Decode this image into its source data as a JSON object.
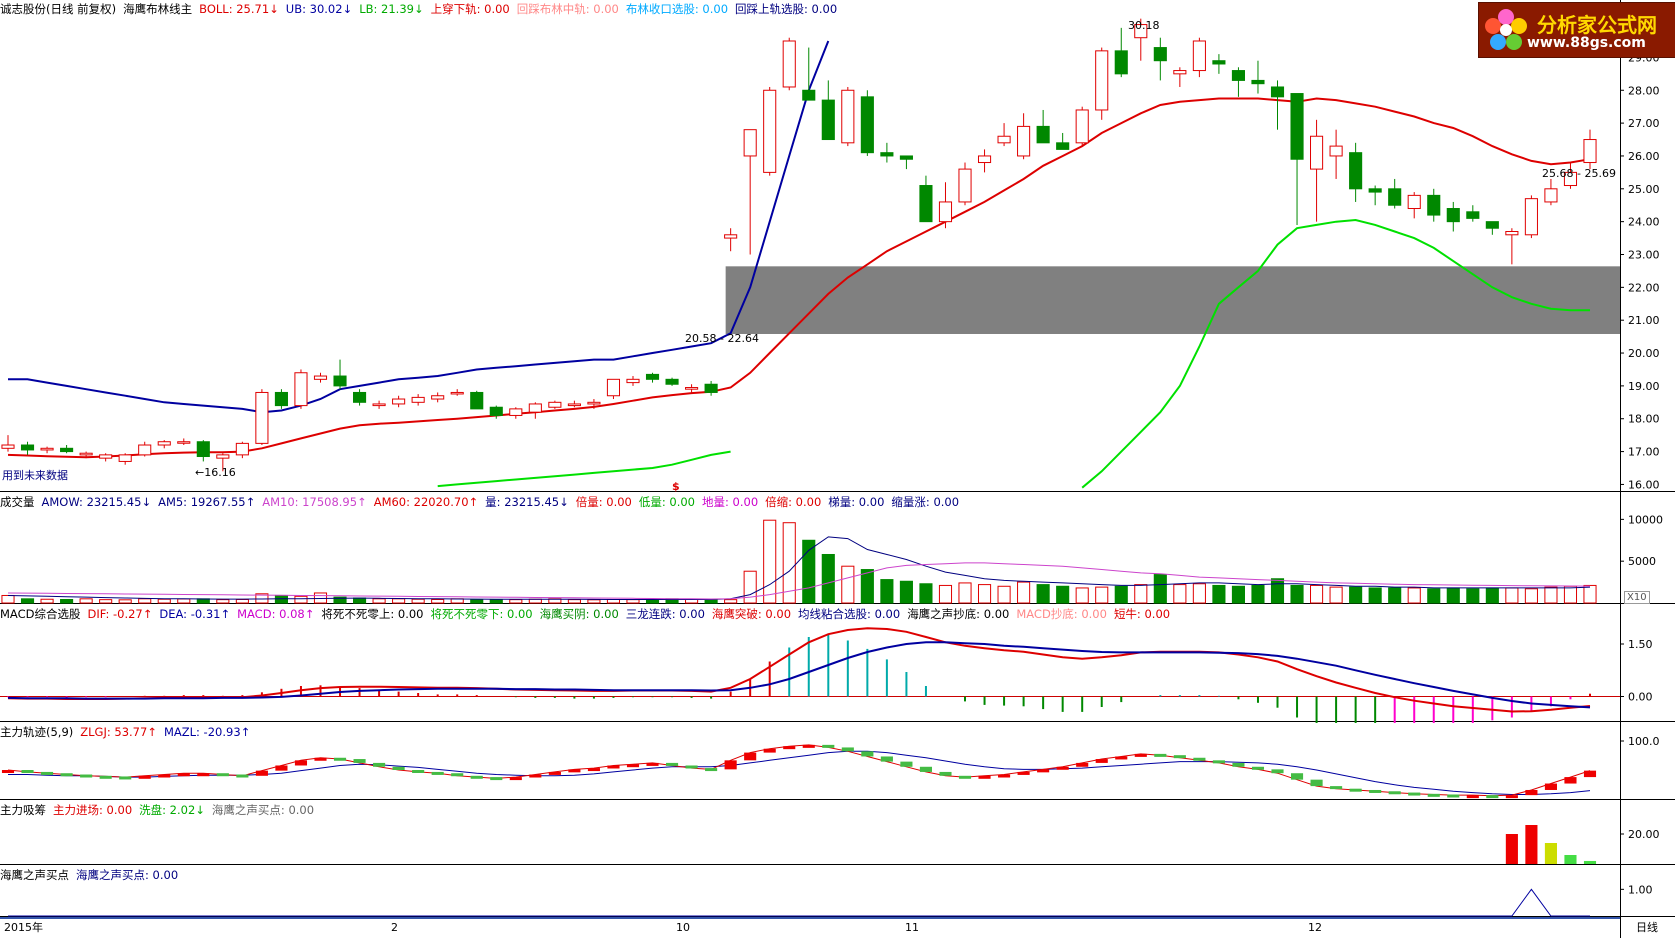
{
  "colors": {
    "up": "#e00000",
    "down": "#008800",
    "upper_band": "#0000a0",
    "mid_band": "#dd0000",
    "lower_band": "#00e000",
    "axis": "#000000",
    "ma_purple": "#cc44cc"
  },
  "logo": {
    "brand": "分析家公式网",
    "url": "www.88gs.com"
  },
  "header_main": {
    "stock": "诚志股份(日线 前复权)",
    "indicator": "海鹰布林线主",
    "boll": "BOLL: 25.71↓",
    "ub": "UB: 30.02↓",
    "lb": "LB: 21.39↓",
    "cross": "上穿下轨: 0.00",
    "mid_back": "回踩布林中轨: 0.00",
    "shrink": "布林收口选股: 0.00",
    "upper_back": "回踩上轨选股: 0.00"
  },
  "header_vol": {
    "title": "成交量",
    "amow": "AMOW: 23215.45↓",
    "am5": "AM5: 19267.55↑",
    "am10": "AM10: 17508.95↑",
    "am60": "AM60: 22020.70↑",
    "vol": "量: 23215.45↓",
    "bei": "倍量: 0.00",
    "di": "低量: 0.00",
    "di2": "地量: 0.00",
    "bei2": "倍缩: 0.00",
    "ti": "梯量: 0.00",
    "suo": "缩量涨: 0.00"
  },
  "header_macd": {
    "title": "MACD综合选股",
    "dif": "DIF: -0.27↑",
    "dea": "DEA: -0.31↑",
    "macd": "MACD: 0.08↑",
    "s1": "将死不死零上: 0.00",
    "s2": "将死不死零下: 0.00",
    "s3": "海鹰买阴: 0.00",
    "s4": "三龙连跌: 0.00",
    "s5": "海鹰突破: 0.00",
    "s6": "均线粘合选股: 0.00",
    "s7": "海鹰之声抄底: 0.00",
    "s8": "MACD抄底: 0.00",
    "s9": "短牛: 0.00"
  },
  "header_main_force": {
    "title": "主力轨迹(5,9)",
    "zlgj": "ZLGJ: 53.77↑",
    "mazl": "MAZL: -20.93↑"
  },
  "header_absorb": {
    "title": "主力吸筹",
    "in": "主力进场: 0.00",
    "wash": "洗盘: 2.02↓",
    "buy": "海鹰之声买点: 0.00"
  },
  "header_buy": {
    "title": "海鹰之声买点",
    "value": "海鹰之声买点: 0.00"
  },
  "annotations": {
    "future": "用到未来数据",
    "low": "←16.16",
    "high": "30.18",
    "box_left": "20.58 - 22.64",
    "box_right": "25.68 - 25.69",
    "x10": "X10",
    "s_mark": "$"
  },
  "timeline": {
    "labels": [
      "2015年",
      "2",
      "10",
      "11",
      "12"
    ],
    "mode": "日线"
  },
  "axes": {
    "price": [
      "29.00",
      "28.00",
      "27.00",
      "26.00",
      "25.00",
      "24.00",
      "23.00",
      "22.00",
      "21.00",
      "20.00",
      "19.00",
      "18.00",
      "17.00",
      "16.00"
    ],
    "volume": [
      "10000",
      "5000"
    ],
    "macd": [
      "1.50",
      "0.00"
    ],
    "force": [
      "100.0"
    ],
    "absorb": [
      "20.00"
    ],
    "buy": [
      "1.00"
    ]
  },
  "chart_data": {
    "type": "candlestick",
    "candles": [
      [
        17.1,
        17.5,
        17.0,
        17.2
      ],
      [
        17.2,
        17.3,
        16.9,
        17.05
      ],
      [
        17.05,
        17.15,
        16.95,
        17.1
      ],
      [
        17.1,
        17.2,
        16.95,
        17.0
      ],
      [
        16.9,
        17.0,
        16.8,
        16.95
      ],
      [
        16.8,
        16.95,
        16.7,
        16.9
      ],
      [
        16.7,
        16.95,
        16.6,
        16.9
      ],
      [
        16.9,
        17.3,
        16.85,
        17.2
      ],
      [
        17.2,
        17.35,
        17.1,
        17.3
      ],
      [
        17.3,
        17.4,
        17.2,
        17.3
      ],
      [
        17.3,
        17.35,
        16.7,
        16.85
      ],
      [
        16.8,
        16.95,
        16.4,
        16.9
      ],
      [
        16.9,
        17.3,
        16.8,
        17.25
      ],
      [
        17.25,
        18.9,
        17.2,
        18.8
      ],
      [
        18.8,
        18.9,
        18.3,
        18.4
      ],
      [
        18.4,
        19.5,
        18.3,
        19.4
      ],
      [
        19.2,
        19.4,
        19.1,
        19.3
      ],
      [
        19.3,
        19.8,
        18.9,
        19.0
      ],
      [
        18.8,
        18.9,
        18.4,
        18.5
      ],
      [
        18.4,
        18.55,
        18.3,
        18.45
      ],
      [
        18.45,
        18.7,
        18.35,
        18.6
      ],
      [
        18.5,
        18.75,
        18.4,
        18.65
      ],
      [
        18.6,
        18.8,
        18.5,
        18.7
      ],
      [
        18.8,
        18.9,
        18.7,
        18.8
      ],
      [
        18.8,
        18.85,
        18.3,
        18.3
      ],
      [
        18.35,
        18.4,
        18.0,
        18.1
      ],
      [
        18.1,
        18.35,
        18.0,
        18.3
      ],
      [
        18.2,
        18.5,
        18.0,
        18.45
      ],
      [
        18.35,
        18.55,
        18.3,
        18.5
      ],
      [
        18.4,
        18.55,
        18.35,
        18.45
      ],
      [
        18.45,
        18.6,
        18.3,
        18.5
      ],
      [
        18.7,
        19.2,
        18.6,
        19.2
      ],
      [
        19.1,
        19.3,
        19.0,
        19.2
      ],
      [
        19.35,
        19.4,
        19.1,
        19.2
      ],
      [
        19.2,
        19.25,
        19.0,
        19.05
      ],
      [
        18.9,
        19.05,
        18.8,
        18.95
      ],
      [
        19.05,
        19.15,
        18.7,
        18.8
      ],
      [
        23.5,
        23.8,
        23.1,
        23.6
      ],
      [
        26.0,
        26.5,
        23.0,
        26.8
      ],
      [
        25.5,
        28.1,
        25.4,
        28.0
      ],
      [
        28.1,
        29.6,
        28.0,
        29.5
      ],
      [
        28.0,
        29.3,
        27.8,
        27.7
      ],
      [
        27.7,
        28.3,
        27.5,
        26.5
      ],
      [
        26.4,
        28.1,
        26.3,
        28.0
      ],
      [
        27.8,
        28.0,
        26.0,
        26.1
      ],
      [
        26.1,
        26.4,
        25.8,
        26.0
      ],
      [
        26.0,
        25.8,
        25.6,
        25.9
      ],
      [
        25.1,
        25.4,
        24.0,
        24.0
      ],
      [
        24.0,
        25.2,
        23.8,
        24.6
      ],
      [
        24.6,
        25.8,
        24.5,
        25.6
      ],
      [
        25.8,
        26.2,
        25.5,
        26.0
      ],
      [
        26.4,
        27.0,
        26.3,
        26.6
      ],
      [
        26.0,
        27.3,
        25.9,
        26.9
      ],
      [
        26.9,
        27.4,
        26.5,
        26.4
      ],
      [
        26.4,
        26.7,
        26.2,
        26.2
      ],
      [
        26.4,
        27.5,
        26.3,
        27.4
      ],
      [
        27.4,
        29.3,
        27.1,
        29.2
      ],
      [
        29.2,
        29.9,
        28.4,
        28.5
      ],
      [
        29.6,
        30.18,
        28.9,
        30.0
      ],
      [
        29.3,
        29.6,
        28.3,
        28.9
      ],
      [
        28.5,
        28.7,
        28.1,
        28.6
      ],
      [
        28.6,
        29.6,
        28.4,
        29.5
      ],
      [
        28.9,
        29.1,
        28.5,
        28.8
      ],
      [
        28.6,
        28.7,
        27.8,
        28.3
      ],
      [
        28.3,
        28.9,
        27.9,
        28.2
      ],
      [
        28.1,
        28.3,
        26.8,
        27.8
      ],
      [
        27.9,
        27.2,
        23.9,
        25.9
      ],
      [
        25.6,
        27.1,
        24.0,
        26.6
      ],
      [
        26.0,
        26.8,
        25.3,
        26.3
      ],
      [
        26.1,
        26.4,
        24.6,
        25.0
      ],
      [
        25.0,
        25.1,
        24.5,
        24.9
      ],
      [
        25.0,
        25.3,
        24.4,
        24.5
      ],
      [
        24.4,
        24.9,
        24.1,
        24.8
      ],
      [
        24.8,
        25.0,
        24.0,
        24.2
      ],
      [
        24.4,
        24.6,
        23.7,
        24.0
      ],
      [
        24.3,
        24.5,
        24.0,
        24.1
      ],
      [
        24.0,
        24.0,
        23.6,
        23.8
      ],
      [
        23.6,
        23.8,
        22.7,
        23.7
      ],
      [
        23.6,
        24.8,
        23.5,
        24.7
      ],
      [
        24.6,
        25.3,
        24.5,
        25.0
      ],
      [
        25.1,
        25.8,
        25.0,
        25.5
      ],
      [
        25.8,
        26.8,
        25.6,
        26.5
      ]
    ],
    "upper_band": [
      19.2,
      19.2,
      19.1,
      19.0,
      18.9,
      18.8,
      18.7,
      18.6,
      18.5,
      18.45,
      18.4,
      18.35,
      18.3,
      18.2,
      18.25,
      18.4,
      18.6,
      18.9,
      19.0,
      19.1,
      19.2,
      19.25,
      19.3,
      19.4,
      19.5,
      19.55,
      19.6,
      19.65,
      19.7,
      19.75,
      19.8,
      19.8,
      19.9,
      20.0,
      20.1,
      20.2,
      20.3,
      20.6,
      22.0,
      24.0,
      26.0,
      28.0,
      29.5,
      30.5,
      31.5,
      32.0,
      null,
      null,
      null,
      null,
      null,
      null,
      null,
      null,
      null,
      null,
      null,
      null,
      null,
      null,
      null,
      null,
      null,
      null,
      null,
      null,
      null,
      null,
      null,
      null,
      null,
      null,
      null,
      null,
      null,
      null,
      null,
      null,
      null,
      null,
      null,
      null
    ],
    "mid_band": [
      16.9,
      16.88,
      16.86,
      16.84,
      16.83,
      16.85,
      16.88,
      16.92,
      16.95,
      16.97,
      16.98,
      16.98,
      17.0,
      17.1,
      17.25,
      17.4,
      17.55,
      17.7,
      17.8,
      17.85,
      17.88,
      17.92,
      17.96,
      18.0,
      18.05,
      18.1,
      18.15,
      18.2,
      18.25,
      18.3,
      18.36,
      18.45,
      18.55,
      18.65,
      18.72,
      18.78,
      18.82,
      18.95,
      19.4,
      20.0,
      20.6,
      21.2,
      21.8,
      22.3,
      22.7,
      23.1,
      23.4,
      23.7,
      24.0,
      24.3,
      24.6,
      24.95,
      25.3,
      25.7,
      26.0,
      26.3,
      26.7,
      27.0,
      27.3,
      27.55,
      27.65,
      27.7,
      27.75,
      27.75,
      27.75,
      27.7,
      27.65,
      27.75,
      27.7,
      27.6,
      27.5,
      27.35,
      27.2,
      27.0,
      26.85,
      26.6,
      26.3,
      26.05,
      25.85,
      25.75,
      25.8,
      25.9
    ],
    "lower_band": [
      null,
      null,
      null,
      null,
      null,
      null,
      null,
      null,
      null,
      null,
      null,
      null,
      null,
      null,
      null,
      null,
      null,
      null,
      null,
      null,
      null,
      null,
      15.95,
      16.0,
      16.05,
      16.1,
      16.15,
      16.2,
      16.25,
      16.3,
      16.35,
      16.4,
      16.45,
      16.5,
      16.6,
      16.75,
      16.9,
      17.0,
      15.5,
      null,
      null,
      null,
      null,
      null,
      null,
      null,
      null,
      null,
      null,
      null,
      null,
      null,
      null,
      null,
      null,
      15.9,
      16.4,
      17.0,
      17.6,
      18.2,
      19.0,
      20.2,
      21.5,
      22.0,
      22.5,
      23.3,
      23.8,
      23.9,
      24.0,
      24.05,
      23.9,
      23.7,
      23.5,
      23.2,
      22.8,
      22.4,
      22.0,
      21.7,
      21.5,
      21.35,
      21.3,
      21.3
    ],
    "volume": [
      900,
      500,
      450,
      420,
      500,
      400,
      380,
      500,
      450,
      480,
      500,
      400,
      420,
      1100,
      900,
      800,
      1200,
      700,
      600,
      500,
      500,
      450,
      420,
      500,
      400,
      380,
      400,
      450,
      500,
      400,
      380,
      420,
      400,
      380,
      500,
      420,
      390,
      400,
      3800,
      9900,
      9600,
      7500,
      5800,
      4400,
      4000,
      2800,
      2600,
      2300,
      2100,
      2400,
      2200,
      2000,
      2500,
      2200,
      2000,
      1800,
      1900,
      2000,
      2200,
      3400,
      2200,
      2300,
      2100,
      2000,
      2100,
      2900,
      2100,
      2100,
      1900,
      1900,
      1800,
      1800,
      1800,
      1700,
      1800,
      1700,
      1800,
      1800,
      1700,
      1900,
      2000,
      2100
    ],
    "am5": [
      900,
      850,
      800,
      750,
      700,
      650,
      600,
      550,
      520,
      500,
      480,
      470,
      470,
      480,
      500,
      520,
      540,
      560,
      580,
      560,
      540,
      520,
      500,
      480,
      470,
      460,
      450,
      450,
      450,
      440,
      430,
      420,
      420,
      420,
      420,
      420,
      420,
      500,
      1000,
      2200,
      3800,
      6300,
      7900,
      7700,
      6400,
      5800,
      5200,
      4400,
      3700,
      3300,
      2900,
      2700,
      2600,
      2500,
      2400,
      2300,
      2200,
      2100,
      2100,
      2200,
      2300,
      2400,
      2400,
      2300,
      2200,
      2300,
      2300,
      2200,
      2100,
      2000,
      2000,
      1900,
      1900,
      1800,
      1800,
      1800,
      1800,
      1800,
      1800,
      1800,
      1800,
      1900
    ],
    "am60": [
      1200,
      1180,
      1160,
      1140,
      1120,
      1100,
      1080,
      1060,
      1040,
      1020,
      1000,
      980,
      960,
      940,
      920,
      900,
      880,
      860,
      840,
      820,
      800,
      780,
      760,
      740,
      720,
      700,
      680,
      660,
      640,
      620,
      600,
      580,
      560,
      540,
      520,
      500,
      480,
      520,
      700,
      1000,
      1400,
      1800,
      2400,
      3000,
      3600,
      4200,
      4500,
      4600,
      4700,
      4800,
      4800,
      4700,
      4600,
      4500,
      4400,
      4200,
      4000,
      3800,
      3600,
      3500,
      3300,
      3100,
      3000,
      2900,
      2800,
      2700,
      2600,
      2500,
      2400,
      2350,
      2300,
      2250,
      2200,
      2180,
      2150,
      2120,
      2100,
      2080,
      2060,
      2040,
      2030,
      2020
    ],
    "dif": [
      -0.05,
      -0.06,
      -0.06,
      -0.07,
      -0.07,
      -0.07,
      -0.06,
      -0.05,
      -0.04,
      -0.03,
      -0.03,
      -0.03,
      -0.02,
      0.03,
      0.1,
      0.18,
      0.24,
      0.27,
      0.28,
      0.28,
      0.27,
      0.26,
      0.25,
      0.25,
      0.24,
      0.22,
      0.2,
      0.19,
      0.18,
      0.17,
      0.16,
      0.16,
      0.17,
      0.17,
      0.17,
      0.16,
      0.14,
      0.25,
      0.5,
      0.85,
      1.2,
      1.55,
      1.78,
      1.9,
      1.95,
      1.93,
      1.85,
      1.7,
      1.55,
      1.45,
      1.38,
      1.32,
      1.28,
      1.2,
      1.12,
      1.08,
      1.12,
      1.18,
      1.26,
      1.28,
      1.28,
      1.28,
      1.26,
      1.2,
      1.12,
      1.0,
      0.78,
      0.58,
      0.4,
      0.25,
      0.1,
      -0.02,
      -0.12,
      -0.2,
      -0.28,
      -0.33,
      -0.38,
      -0.43,
      -0.42,
      -0.38,
      -0.32,
      -0.27
    ],
    "dea": [
      -0.04,
      -0.05,
      -0.05,
      -0.05,
      -0.06,
      -0.06,
      -0.06,
      -0.06,
      -0.05,
      -0.05,
      -0.05,
      -0.04,
      -0.04,
      -0.03,
      -0.01,
      0.03,
      0.08,
      0.13,
      0.16,
      0.18,
      0.2,
      0.21,
      0.22,
      0.22,
      0.22,
      0.22,
      0.21,
      0.21,
      0.2,
      0.2,
      0.19,
      0.18,
      0.18,
      0.18,
      0.18,
      0.18,
      0.17,
      0.18,
      0.25,
      0.35,
      0.5,
      0.7,
      0.9,
      1.1,
      1.27,
      1.4,
      1.5,
      1.55,
      1.55,
      1.52,
      1.5,
      1.45,
      1.42,
      1.38,
      1.34,
      1.3,
      1.27,
      1.26,
      1.26,
      1.26,
      1.26,
      1.26,
      1.25,
      1.24,
      1.21,
      1.16,
      1.08,
      0.98,
      0.88,
      0.75,
      0.62,
      0.5,
      0.38,
      0.27,
      0.16,
      0.06,
      -0.04,
      -0.13,
      -0.2,
      -0.24,
      -0.28,
      -0.31
    ],
    "zlgj": [
      55,
      52,
      50,
      48,
      46,
      45,
      44,
      46,
      48,
      50,
      50,
      48,
      46,
      54,
      62,
      70,
      74,
      72,
      66,
      60,
      55,
      52,
      50,
      46,
      44,
      42,
      44,
      48,
      52,
      56,
      58,
      62,
      64,
      66,
      62,
      58,
      56,
      70,
      82,
      88,
      92,
      94,
      90,
      84,
      76,
      68,
      60,
      52,
      46,
      44,
      46,
      48,
      52,
      56,
      60,
      66,
      72,
      76,
      80,
      78,
      74,
      70,
      66,
      60,
      56,
      50,
      40,
      30,
      26,
      24,
      22,
      20,
      18,
      17,
      16,
      16,
      15,
      16,
      24,
      34,
      44,
      54
    ],
    "mazl": [
      48,
      48,
      47,
      46,
      46,
      45,
      44,
      44,
      45,
      46,
      47,
      47,
      47,
      48,
      50,
      54,
      58,
      62,
      64,
      63,
      61,
      59,
      56,
      53,
      50,
      48,
      47,
      46,
      46,
      47,
      49,
      52,
      55,
      58,
      60,
      60,
      60,
      62,
      66,
      70,
      74,
      78,
      82,
      84,
      84,
      82,
      78,
      74,
      69,
      64,
      60,
      57,
      56,
      56,
      57,
      58,
      60,
      62,
      64,
      66,
      68,
      68,
      68,
      67,
      66,
      64,
      60,
      55,
      49,
      43,
      37,
      32,
      28,
      25,
      22,
      20,
      18,
      17,
      17,
      18,
      20,
      23
    ],
    "absorb": [
      0,
      0,
      0,
      0,
      0,
      0,
      0,
      0,
      0,
      0,
      0,
      0,
      0,
      0,
      0,
      0,
      0,
      0,
      0,
      0,
      0,
      0,
      0,
      0,
      0,
      0,
      0,
      0,
      0,
      0,
      0,
      0,
      0,
      0,
      0,
      0,
      0,
      0,
      0,
      0,
      0,
      0,
      0,
      0,
      0,
      0,
      0,
      0,
      0,
      0,
      0,
      0,
      0,
      0,
      0,
      0,
      0,
      0,
      0,
      0,
      0,
      0,
      0,
      0,
      0,
      0,
      0,
      0,
      0,
      0,
      0,
      0,
      0,
      0,
      0,
      0,
      0,
      20,
      26,
      14,
      6,
      2.02
    ],
    "buy": [
      0,
      0,
      0,
      0,
      0,
      0,
      0,
      0,
      0,
      0,
      0,
      0,
      0,
      0,
      0,
      0,
      0,
      0,
      0,
      0,
      0,
      0,
      0,
      0,
      0,
      0,
      0,
      0,
      0,
      0,
      0,
      0,
      0,
      0,
      0,
      0,
      0,
      0,
      0,
      0,
      0,
      0,
      0,
      0,
      0,
      0,
      0,
      0,
      0,
      0,
      0,
      0,
      0,
      0,
      0,
      0,
      0,
      0,
      0,
      0,
      0,
      0,
      0,
      0,
      0,
      0,
      0,
      0,
      0,
      0,
      0,
      0,
      0,
      0,
      0,
      0,
      0,
      0,
      1,
      0,
      0,
      0
    ],
    "box_zones": [
      {
        "low": 20.58,
        "high": 22.64
      }
    ],
    "price_range": [
      15.8,
      30.2
    ]
  }
}
